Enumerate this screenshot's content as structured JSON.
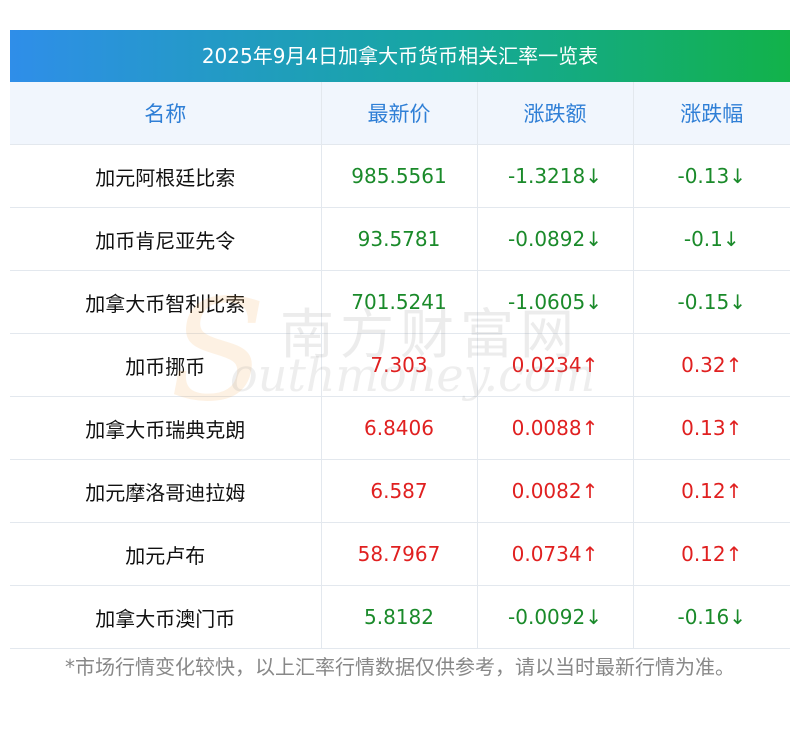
{
  "title": "2025年9月4日加拿大币货币相关汇率一览表",
  "headers": [
    "名称",
    "最新价",
    "涨跌额",
    "涨跌幅"
  ],
  "rows": [
    {
      "name": "加元阿根廷比索",
      "price": "985.5561",
      "change": "-1.3218↓",
      "pct": "-0.13↓",
      "dir": "down"
    },
    {
      "name": "加币肯尼亚先令",
      "price": "93.5781",
      "change": "-0.0892↓",
      "pct": "-0.1↓",
      "dir": "down"
    },
    {
      "name": "加拿大币智利比索",
      "price": "701.5241",
      "change": "-1.0605↓",
      "pct": "-0.15↓",
      "dir": "down"
    },
    {
      "name": "加币挪币",
      "price": "7.303",
      "change": "0.0234↑",
      "pct": "0.32↑",
      "dir": "up"
    },
    {
      "name": "加拿大币瑞典克朗",
      "price": "6.8406",
      "change": "0.0088↑",
      "pct": "0.13↑",
      "dir": "up"
    },
    {
      "name": "加元摩洛哥迪拉姆",
      "price": "6.587",
      "change": "0.0082↑",
      "pct": "0.12↑",
      "dir": "up"
    },
    {
      "name": "加元卢布",
      "price": "58.7967",
      "change": "0.0734↑",
      "pct": "0.12↑",
      "dir": "up"
    },
    {
      "name": "加拿大币澳门币",
      "price": "5.8182",
      "change": "-0.0092↓",
      "pct": "-0.16↓",
      "dir": "down"
    }
  ],
  "watermark": {
    "cn": "南方财富网",
    "en": "outhmoney.com",
    "s": "S"
  },
  "footnote": "*市场行情变化较快，以上汇率行情数据仅供参考，请以当时最新行情为准。",
  "colors": {
    "up": "#e02020",
    "down": "#1a8a2a",
    "header_text": "#2f7fd6"
  }
}
